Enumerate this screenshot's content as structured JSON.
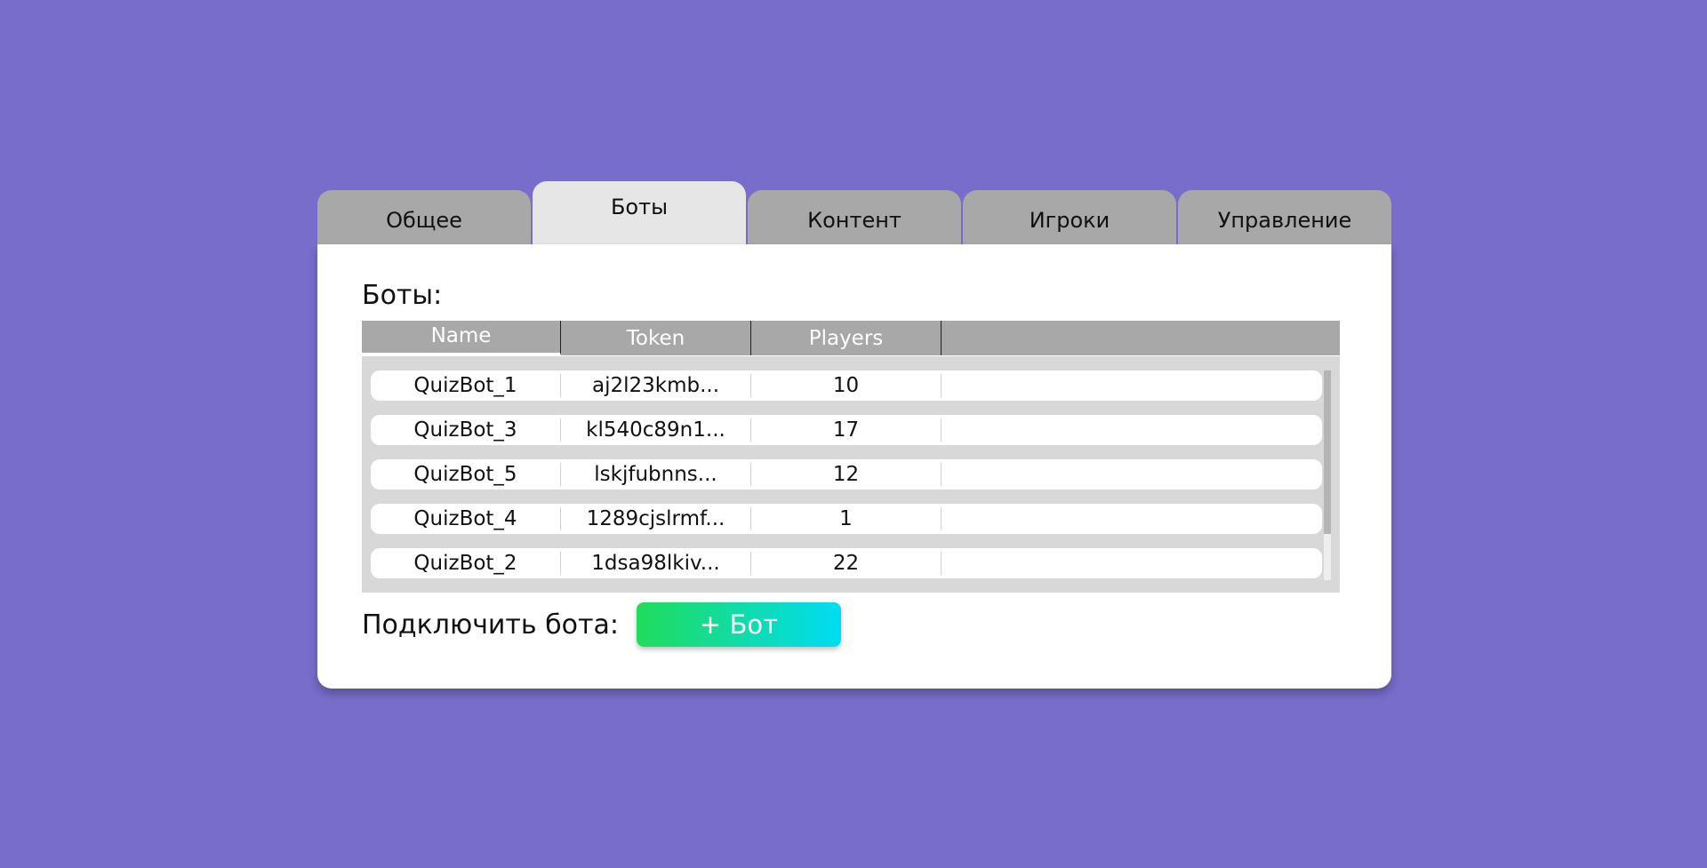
{
  "tabs": [
    {
      "label": "Общее"
    },
    {
      "label": "Боты"
    },
    {
      "label": "Контент"
    },
    {
      "label": "Игроки"
    },
    {
      "label": "Управление"
    }
  ],
  "active_tab": "Боты",
  "section_title": "Боты:",
  "table": {
    "columns": [
      "Name",
      "Token",
      "Players"
    ],
    "rows": [
      {
        "name": "QuizBot_1",
        "token": "aj2l23kmb...",
        "players": "10"
      },
      {
        "name": "QuizBot_3",
        "token": "kl540c89n1...",
        "players": "17"
      },
      {
        "name": "QuizBot_5",
        "token": "lskjfubnns...",
        "players": "12"
      },
      {
        "name": "QuizBot_4",
        "token": "1289cjslrmf...",
        "players": "1"
      },
      {
        "name": "QuizBot_2",
        "token": "1dsa98lkiv...",
        "players": "22"
      }
    ]
  },
  "connect": {
    "label": "Подключить бота:",
    "button_label": "+ Бот"
  },
  "colors": {
    "background": "#786dca",
    "tab_inactive": "#a8a8a8",
    "tab_active": "#e6e6e6",
    "button_gradient_start": "#20dc5c",
    "button_gradient_end": "#00dcf4"
  }
}
